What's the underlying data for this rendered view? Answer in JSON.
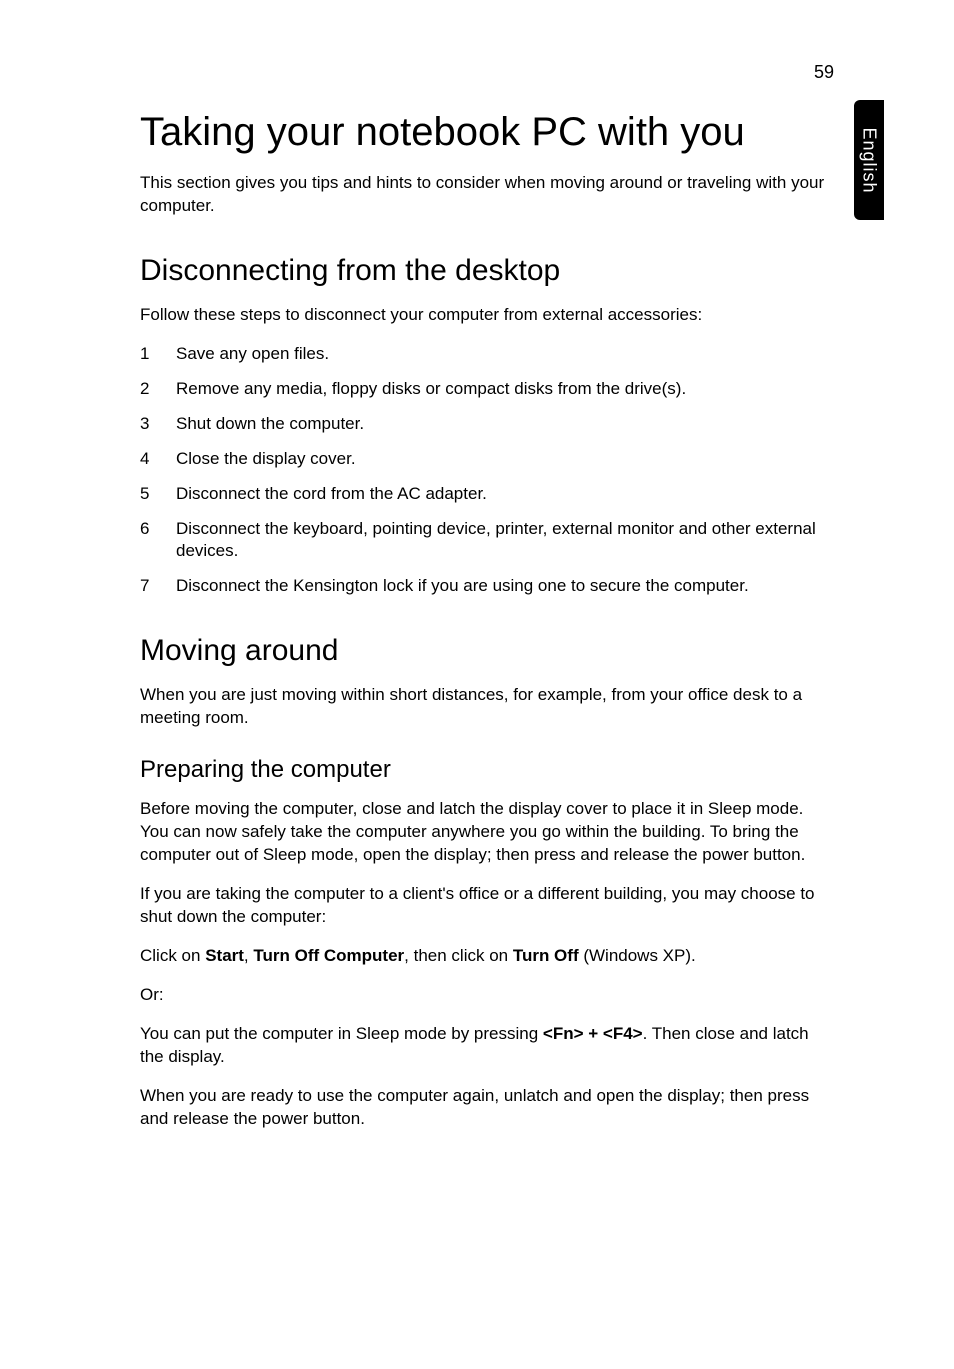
{
  "page_number": "59",
  "side_tab": "English",
  "h1": "Taking your notebook PC with you",
  "intro": "This section gives you tips and hints to consider when moving around or traveling with your computer.",
  "section1": {
    "heading": "Disconnecting from the desktop",
    "lead": "Follow these steps to disconnect your computer from external accessories:",
    "steps": [
      {
        "n": "1",
        "t": "Save any open files."
      },
      {
        "n": "2",
        "t": "Remove any media, floppy disks or compact disks from the drive(s)."
      },
      {
        "n": "3",
        "t": "Shut down the computer."
      },
      {
        "n": "4",
        "t": "Close the display cover."
      },
      {
        "n": "5",
        "t": "Disconnect the cord from the AC adapter."
      },
      {
        "n": "6",
        "t": "Disconnect the keyboard, pointing device, printer, external monitor and other external devices."
      },
      {
        "n": "7",
        "t": "Disconnect the Kensington lock if you are using one to secure the computer."
      }
    ]
  },
  "section2": {
    "heading": "Moving around",
    "lead": "When you are just moving within short distances, for example, from your office desk to a meeting room.",
    "sub": {
      "heading": "Preparing the computer",
      "p1": "Before moving the computer, close and latch the display cover to place it in Sleep mode. You can now safely take the computer anywhere you go within the building. To bring the computer out of Sleep mode, open the display; then press and release the power button.",
      "p2": "If you are taking the computer to a client's office or a different building, you may choose to shut down the computer:",
      "p3_pre": "Click on ",
      "p3_b1": "Start",
      "p3_sep1": ", ",
      "p3_b2": "Turn Off Computer",
      "p3_mid": ", then click on ",
      "p3_b3": "Turn Off",
      "p3_post": " (Windows XP).",
      "or": "Or:",
      "p4_pre": "You can put the computer in Sleep mode by pressing ",
      "p4_b1": "<Fn> + <F4>",
      "p4_post": ". Then close and latch the display.",
      "p5": "When you are ready to use the computer again, unlatch and open the display; then press and release the power button."
    }
  }
}
